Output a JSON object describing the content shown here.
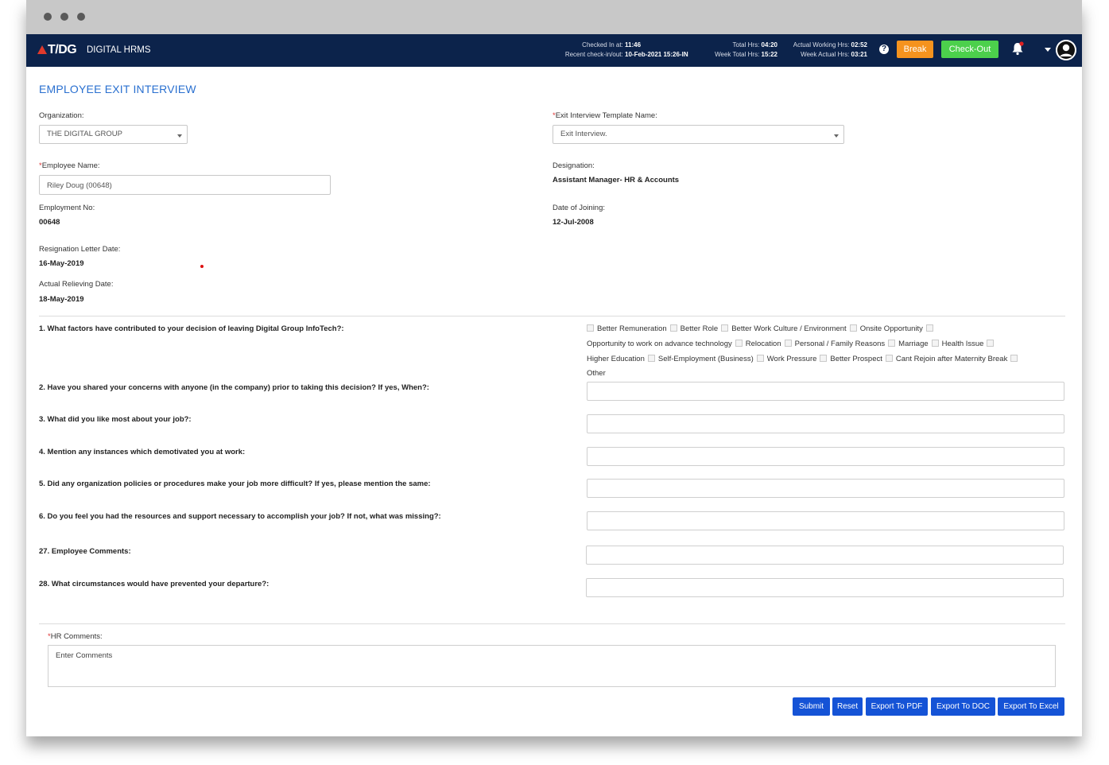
{
  "app": {
    "logo": "T/DG",
    "name": "DIGITAL HRMS"
  },
  "header": {
    "checked_in_label": "Checked In at:",
    "checked_in_value": "11:46",
    "recent_label": "Recent check-in/out:",
    "recent_value": "10-Feb-2021 15:26-IN",
    "total_hrs_label": "Total Hrs:",
    "total_hrs_value": "04:20",
    "week_total_label": "Week Total Hrs:",
    "week_total_value": "15:22",
    "actual_working_label": "Actual Working Hrs:",
    "actual_working_value": "02:52",
    "week_actual_label": "Week Actual Hrs:",
    "week_actual_value": "03:21",
    "break_label": "Break",
    "checkout_label": "Check-Out",
    "help_glyph": "?"
  },
  "page": {
    "title": "EMPLOYEE EXIT INTERVIEW"
  },
  "form": {
    "organization_label": "Organization:",
    "organization_value": "THE DIGITAL GROUP",
    "template_label": "Exit Interview Template Name:",
    "template_value": "Exit Interview.",
    "employee_label": "Employee Name:",
    "employee_value": "Riley Doug (00648)",
    "designation_label": "Designation:",
    "designation_value": "Assistant Manager- HR & Accounts",
    "employment_no_label": "Employment No:",
    "employment_no_value": "00648",
    "doj_label": "Date of Joining:",
    "doj_value": "12-Jul-2008",
    "resignation_label": "Resignation Letter Date:",
    "resignation_value": "16-May-2019",
    "relieving_label": "Actual Relieving Date:",
    "relieving_value": "18-May-2019",
    "required_mark": "*"
  },
  "questions": [
    "1. What factors have contributed to your decision of leaving Digital Group InfoTech?:",
    "2. Have you shared your concerns with anyone (in the company) prior to taking this decision? If yes, When?:",
    "3. What did you like most about your job?:",
    "4. Mention any instances which demotivated you at work:",
    "5. Did any organization policies or procedures make your job more difficult? If yes, please mention the same:",
    "6. Do you feel you had the resources and support necessary to accomplish your job? If not, what was missing?:",
    "27. Employee Comments:",
    "28. What circumstances would have prevented your departure?:"
  ],
  "factors": [
    "Better Remuneration",
    "Better Role",
    "Better Work Culture / Environment",
    "Onsite Opportunity",
    "Opportunity to work on advance technology",
    "Relocation",
    "Personal / Family Reasons",
    "Marriage",
    "Health Issue",
    "Higher Education",
    "Self-Employment (Business)",
    "Work Pressure",
    "Better Prospect",
    "Cant Rejoin after Maternity Break",
    "Other"
  ],
  "hr": {
    "label": "HR Comments:",
    "placeholder": "Enter Comments"
  },
  "actions": {
    "submit": "Submit",
    "reset": "Reset",
    "pdf": "Export To PDF",
    "doc": "Export To DOC",
    "excel": "Export To Excel"
  },
  "colors": {
    "nav": "#0c234b",
    "title": "#2a70d0",
    "break": "#f5931e",
    "checkout": "#4cd04c",
    "action": "#1553d6"
  }
}
